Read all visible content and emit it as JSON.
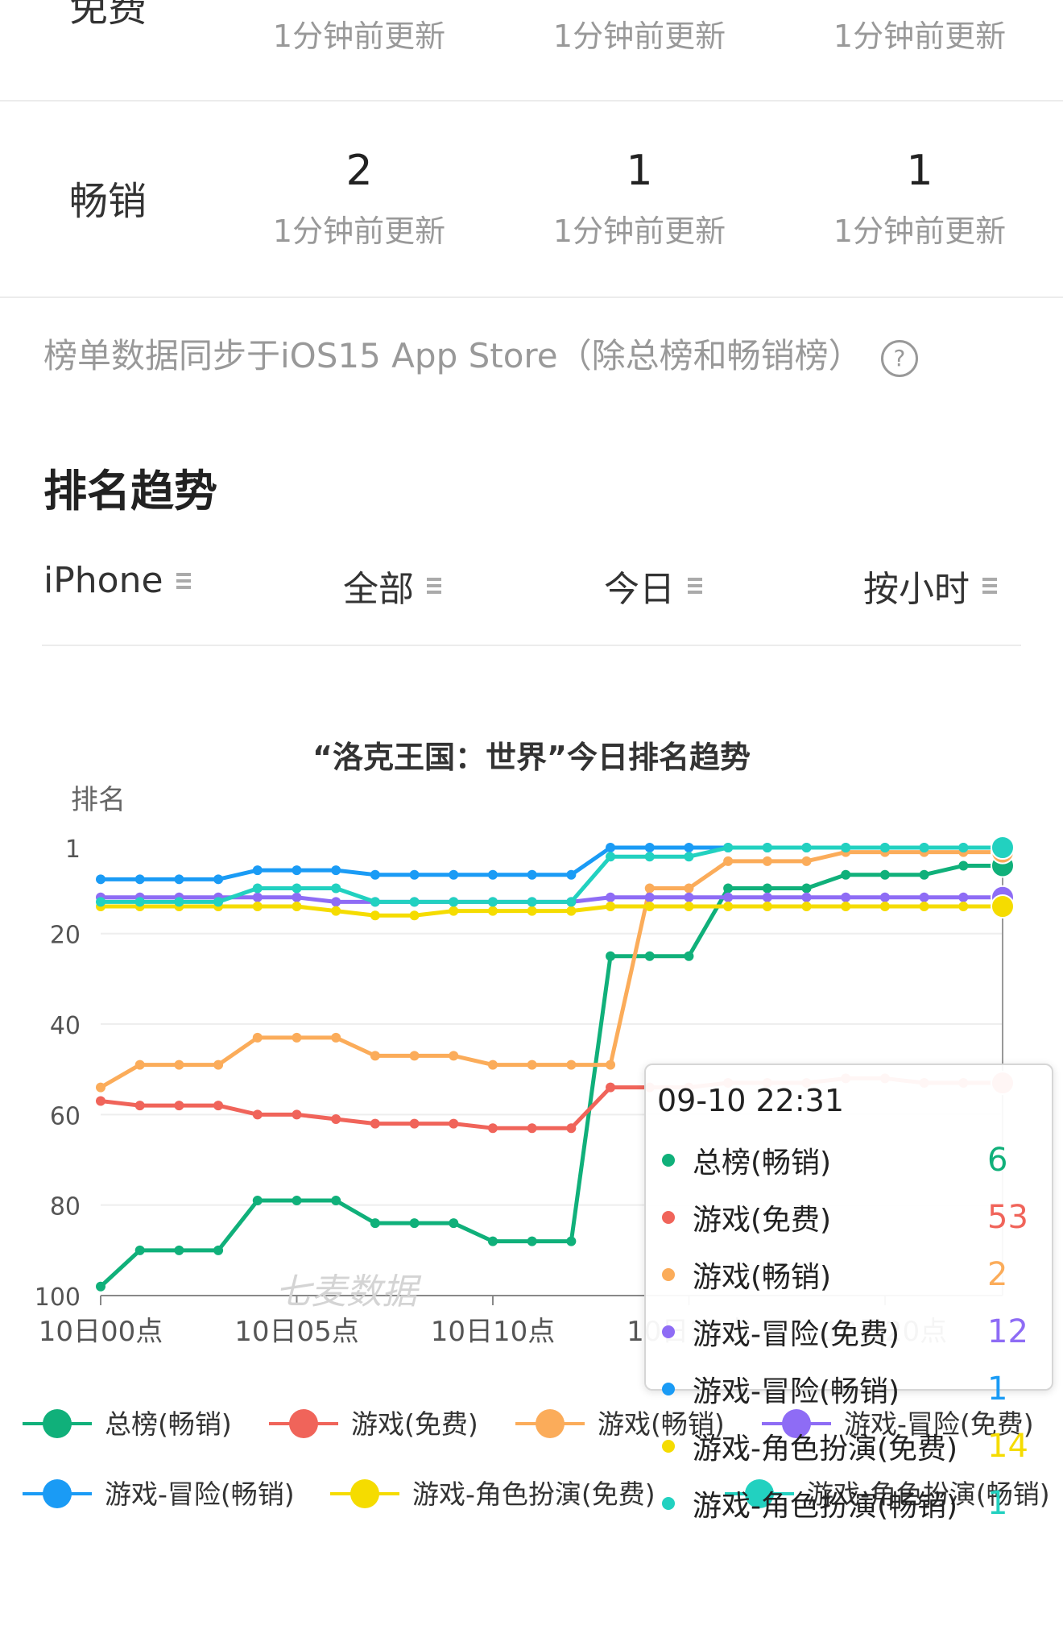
{
  "top_row": {
    "label": "免费",
    "updates": [
      "1分钟前更新",
      "1分钟前更新",
      "1分钟前更新"
    ]
  },
  "bestseller_row": {
    "label": "畅销",
    "cells": [
      {
        "rank": "2",
        "update": "1分钟前更新"
      },
      {
        "rank": "1",
        "update": "1分钟前更新"
      },
      {
        "rank": "1",
        "update": "1分钟前更新"
      }
    ]
  },
  "note": {
    "text": "榜单数据同步于iOS15 App Store（除总榜和畅销榜）",
    "help_icon": "question-circle-icon",
    "help_glyph": "?"
  },
  "section": {
    "title": "排名趋势"
  },
  "filters": [
    {
      "label": "iPhone"
    },
    {
      "label": "全部"
    },
    {
      "label": "今日"
    },
    {
      "label": "按小时"
    }
  ],
  "chart_data": {
    "type": "line",
    "title": "“洛克王国：世界”今日排名趋势",
    "ylabel": "排名",
    "xlabel": "",
    "watermark": "七麦数据",
    "y_inverted": true,
    "ylim": [
      1,
      100
    ],
    "y_ticks": [
      1,
      20,
      40,
      60,
      80,
      100
    ],
    "x_tick_labels": [
      "10日00点",
      "10日05点",
      "10日10点",
      "10日15点",
      "10日20点"
    ],
    "x_ticks_hours": [
      0,
      5,
      10,
      15,
      20
    ],
    "x": [
      0,
      1,
      2,
      3,
      4,
      5,
      6,
      7,
      8,
      9,
      10,
      11,
      12,
      13,
      14,
      15,
      16,
      17,
      18,
      19,
      20,
      21,
      22,
      23
    ],
    "legend": {
      "position": "bottom"
    },
    "series": [
      {
        "name": "总榜(畅销)",
        "color": "#10b07a",
        "values": [
          98,
          90,
          90,
          90,
          79,
          79,
          79,
          84,
          84,
          84,
          88,
          88,
          88,
          25,
          25,
          25,
          10,
          10,
          10,
          7,
          7,
          7,
          5,
          5
        ]
      },
      {
        "name": "游戏(免费)",
        "color": "#f0645a",
        "values": [
          57,
          58,
          58,
          58,
          60,
          60,
          61,
          62,
          62,
          62,
          63,
          63,
          63,
          54,
          54,
          54,
          53,
          53,
          53,
          52,
          52,
          53,
          53,
          53
        ]
      },
      {
        "name": "游戏(畅销)",
        "color": "#fbac5a",
        "values": [
          54,
          49,
          49,
          49,
          43,
          43,
          43,
          47,
          47,
          47,
          49,
          49,
          49,
          49,
          10,
          10,
          4,
          4,
          4,
          2,
          2,
          2,
          2,
          2
        ]
      },
      {
        "name": "游戏-冒险(免费)",
        "color": "#8e6cf5",
        "values": [
          12,
          12,
          12,
          12,
          12,
          12,
          13,
          13,
          13,
          13,
          13,
          13,
          13,
          12,
          12,
          12,
          12,
          12,
          12,
          12,
          12,
          12,
          12,
          12
        ]
      },
      {
        "name": "游戏-冒险(畅销)",
        "color": "#1a9bf5",
        "values": [
          8,
          8,
          8,
          8,
          6,
          6,
          6,
          7,
          7,
          7,
          7,
          7,
          7,
          1,
          1,
          1,
          1,
          1,
          1,
          1,
          1,
          1,
          1,
          1
        ]
      },
      {
        "name": "游戏-角色扮演(免费)",
        "color": "#f5dc00",
        "values": [
          14,
          14,
          14,
          14,
          14,
          14,
          15,
          16,
          16,
          15,
          15,
          15,
          15,
          14,
          14,
          14,
          14,
          14,
          14,
          14,
          14,
          14,
          14,
          14
        ]
      },
      {
        "name": "游戏-角色扮演(畅销)",
        "color": "#22d1c0",
        "values": [
          13,
          13,
          13,
          13,
          10,
          10,
          10,
          13,
          13,
          13,
          13,
          13,
          13,
          3,
          3,
          3,
          1,
          1,
          1,
          1,
          1,
          1,
          1,
          1
        ]
      }
    ],
    "tooltip": {
      "title": "09-10 22:31",
      "values": [
        "6",
        "53",
        "2",
        "12",
        "1",
        "14",
        "1"
      ]
    }
  }
}
